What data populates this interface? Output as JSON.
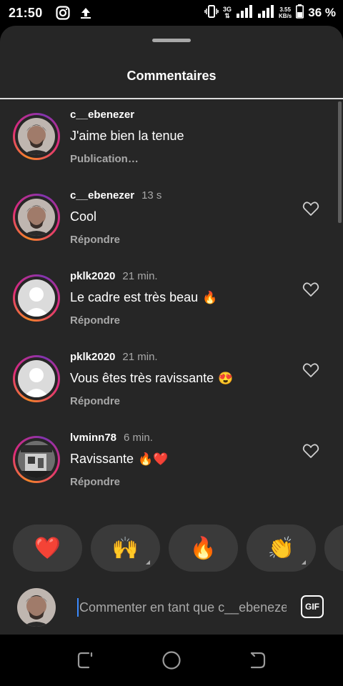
{
  "status_bar": {
    "time": "21:50",
    "network": "3G",
    "speed_value": "3.55",
    "speed_unit": "KB/s",
    "battery": "36 %"
  },
  "sheet": {
    "title": "Commentaires"
  },
  "comments": [
    {
      "username": "c__ebenezer",
      "time": "",
      "text": "J'aime bien la tenue",
      "emojis": "",
      "action": "Publication…",
      "has_like": false,
      "avatar": "user-photo"
    },
    {
      "username": "c__ebenezer",
      "time": "13 s",
      "text": "Cool",
      "emojis": "",
      "action": "Répondre",
      "has_like": true,
      "avatar": "user-photo"
    },
    {
      "username": "pklk2020",
      "time": "21 min.",
      "text": "Le cadre est très beau",
      "emojis": "🔥",
      "action": "Répondre",
      "has_like": true,
      "avatar": "default-avatar"
    },
    {
      "username": "pklk2020",
      "time": "21 min.",
      "text": "Vous êtes très ravissante",
      "emojis": "😍",
      "action": "Répondre",
      "has_like": true,
      "avatar": "default-avatar"
    },
    {
      "username": "lvminn78",
      "time": "6 min.",
      "text": "Ravissante",
      "emojis": "🔥❤️",
      "action": "Répondre",
      "has_like": true,
      "avatar": "photo-bw"
    }
  ],
  "reactions": [
    {
      "emoji": "❤️",
      "icon": "heart-emoji",
      "more": false
    },
    {
      "emoji": "🙌",
      "icon": "raising-hands-emoji",
      "more": true
    },
    {
      "emoji": "🔥",
      "icon": "fire-emoji",
      "more": false
    },
    {
      "emoji": "👏",
      "icon": "clapping-hands-emoji",
      "more": true
    }
  ],
  "composer": {
    "placeholder": "Commenter en tant que c__ebenezer...",
    "gif_label": "GIF"
  },
  "colors": {
    "sheet_bg": "#262626",
    "muted_text": "#a8a8a8",
    "reaction_bg": "#3a3a3a",
    "ring_orange": "#f58529",
    "ring_pink": "#dd2a7b"
  }
}
